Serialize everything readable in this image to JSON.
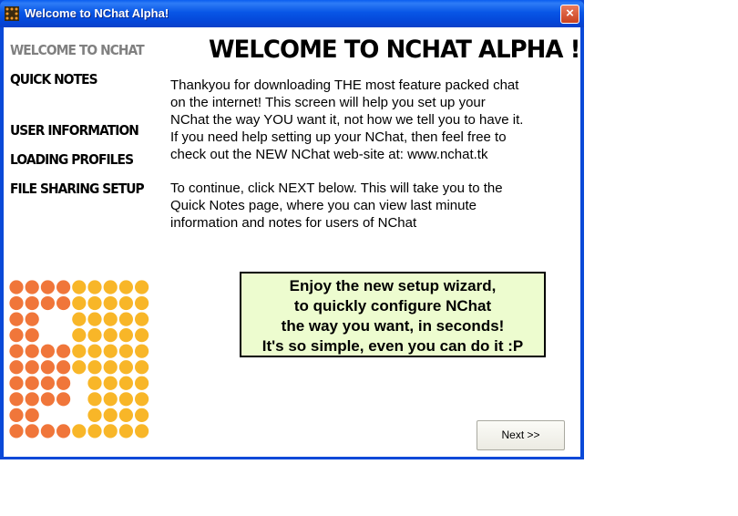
{
  "window": {
    "title": "Welcome to NChat Alpha!",
    "close_label": "×"
  },
  "nav": {
    "items": [
      {
        "label": "WELCOME TO NCHAT",
        "active": true
      },
      {
        "label": "QUICK NOTES",
        "active": false
      },
      {
        "label": "USER INFORMATION",
        "active": false
      },
      {
        "label": "LOADING PROFILES",
        "active": false
      },
      {
        "label": "FILE SHARING SETUP",
        "active": false
      }
    ]
  },
  "main": {
    "heading": "WELCOME TO NCHAT ALPHA !",
    "paragraph1": [
      "Thankyou for downloading THE most feature packed chat",
      "on the internet! This screen will help you set up your",
      "NChat the way YOU want it, not how we tell you to have it.",
      "If you need help setting up your NChat, then feel free to",
      "check out the NEW NChat web-site at: www.nchat.tk"
    ],
    "paragraph2": [
      "To continue, click NEXT below. This will take you to the",
      "Quick Notes page, where you can view last minute",
      "information and notes for users of NChat"
    ],
    "callout": [
      "Enjoy the new setup wizard,",
      "to quickly configure NChat",
      "the way you want, in seconds!",
      "It's so simple, even you can do it :P"
    ]
  },
  "footer": {
    "next_label": "Next >>"
  },
  "colors": {
    "titlebar": "#0a56e6",
    "callout_bg": "#edfccf",
    "logo_dark": "#f0763a",
    "logo_light": "#f8b628",
    "nav_active": "#808080"
  }
}
